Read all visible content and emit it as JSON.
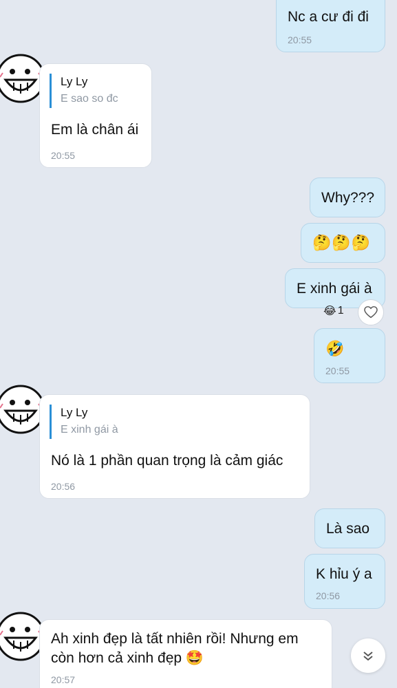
{
  "messages": {
    "m1": {
      "text": "Nc a cư đi đi",
      "time": "20:55"
    },
    "m2": {
      "reply_name": "Ly Ly",
      "reply_text": "E sao so đc",
      "text": "Em là chân ái",
      "time": "20:55"
    },
    "m3": {
      "text": "Why???"
    },
    "m4": {
      "emojis": "🤔🤔🤔"
    },
    "m5": {
      "text": "E xinh gái à",
      "reaction_emoji": "😂",
      "reaction_count": "1"
    },
    "m6": {
      "emoji": "🤣",
      "time": "20:55"
    },
    "m7": {
      "reply_name": "Ly Ly",
      "reply_text": "E xinh gái à",
      "text": "Nó là 1 phần quan trọng là cảm giác",
      "time": "20:56"
    },
    "m8": {
      "text": "Là sao"
    },
    "m9": {
      "text": "K hỉu ý a",
      "time": "20:56"
    },
    "m10": {
      "line1": "Ah xinh đẹp là tất nhiên rồi! Nhưng em",
      "line2": "còn hơn cả xinh đẹp",
      "emoji": "🤩",
      "time": "20:57"
    }
  },
  "colors": {
    "background": "#e3e8f0",
    "outgoing_bubble": "#d4ecf9",
    "incoming_bubble": "#ffffff",
    "reply_bar": "#2a8fd6",
    "timestamp": "#8f98a3"
  },
  "icons": {
    "avatar": "smiley-sticker-avatar",
    "heart": "heart-outline-icon",
    "scroll": "double-chevron-down-icon"
  }
}
